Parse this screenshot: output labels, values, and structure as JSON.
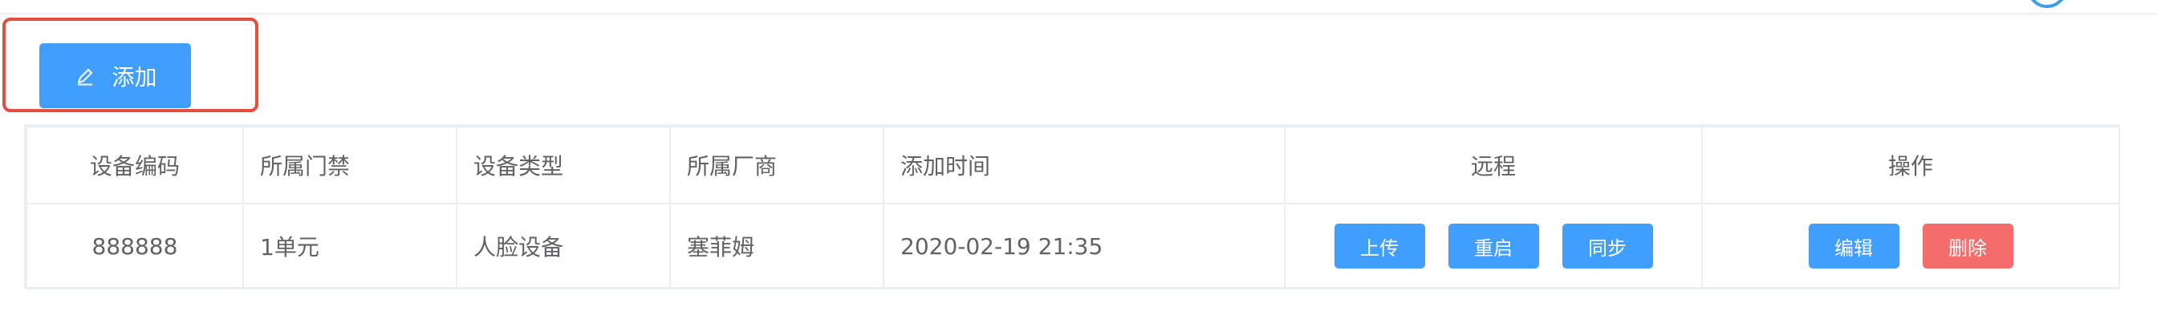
{
  "toolbar": {
    "add_label": "添加"
  },
  "table": {
    "headers": [
      "设备编码",
      "所属门禁",
      "设备类型",
      "所属厂商",
      "添加时间",
      "远程",
      "操作"
    ],
    "rows": [
      {
        "code": "888888",
        "gate": "1单元",
        "type": "人脸设备",
        "vendor": "塞菲姆",
        "added_time": "2020-02-19 21:35",
        "remote_actions": [
          "上传",
          "重启",
          "同步"
        ],
        "ops": [
          "编辑",
          "删除"
        ]
      }
    ]
  },
  "colors": {
    "primary": "#409eff",
    "danger": "#f56c6c",
    "highlight": "#e74c3c"
  },
  "icons": {
    "add_button_icon": "edit-pen-icon"
  }
}
